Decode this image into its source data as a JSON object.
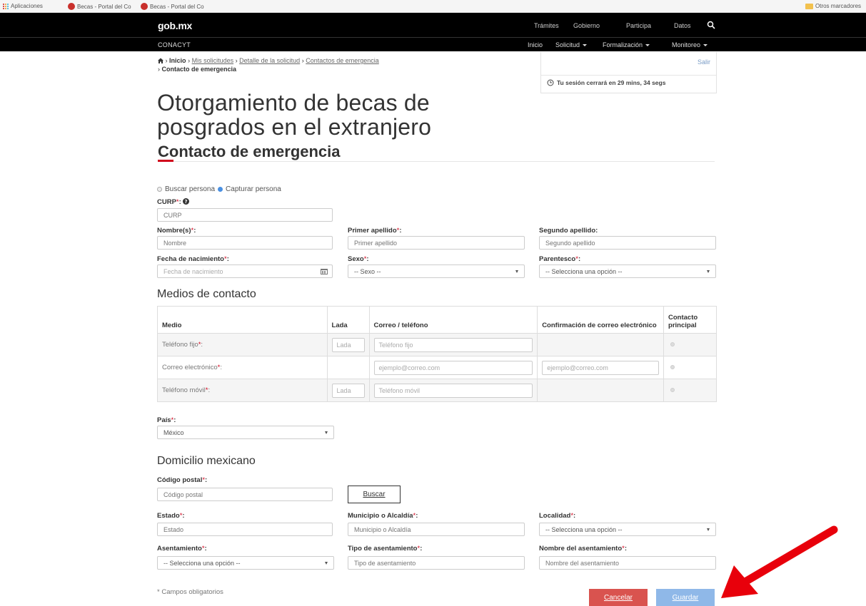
{
  "browser": {
    "bookmarks": [
      {
        "label": "Aplicaciones",
        "icon": "apps-grid-icon"
      },
      {
        "label": "Becas - Portal del Co",
        "icon": "red-circle-icon"
      },
      {
        "label": "Becas - Portal del Co",
        "icon": "red-circle-icon"
      }
    ],
    "other_bookmarks": "Otros marcadores"
  },
  "gob": {
    "logo": "gob.mx",
    "nav": [
      "Trámites",
      "Gobierno",
      "Participa",
      "Datos"
    ]
  },
  "conacyt": {
    "brand": "CONACYT",
    "nav": [
      "Inicio",
      "Solicitud",
      "Formalización",
      "Monitoreo"
    ]
  },
  "breadcrumb": {
    "home": "Inicio",
    "sep": "›",
    "links": [
      "Mis solicitudes",
      "Detalle de la solicitud",
      "Contactos de emergencia"
    ],
    "current": "Contacto de emergencia"
  },
  "session": {
    "logout": "Salir",
    "timer": "Tu sesión cerrará en 29 mins, 34 segs"
  },
  "page": {
    "title_line1": "Otorgamiento de becas de",
    "title_line2": "posgrados en el extranjero",
    "subtitle": "Contacto de emergencia",
    "accent_color": "#d0021b"
  },
  "form": {
    "mode": {
      "option_search": "Buscar persona",
      "option_capture": "Capturar persona",
      "selected": "Capturar persona"
    },
    "curp": {
      "label": "CURP",
      "placeholder": "CURP"
    },
    "nombre": {
      "label": "Nombre(s)",
      "placeholder": "Nombre"
    },
    "primer_apellido": {
      "label": "Primer apellido",
      "placeholder": "Primer apellido"
    },
    "segundo_apellido": {
      "label": "Segundo apellido:",
      "placeholder": "Segundo apellido"
    },
    "fecha": {
      "label": "Fecha de nacimiento",
      "placeholder": "Fecha de nacimiento"
    },
    "sexo": {
      "label": "Sexo",
      "value": "-- Sexo --"
    },
    "parentesco": {
      "label": "Parentesco",
      "value": "-- Selecciona una opción --"
    },
    "req_mark": "*",
    "colon": ":"
  },
  "contact": {
    "heading": "Medios de contacto",
    "headers": [
      "Medio",
      "Lada",
      "Correo / teléfono",
      "Confirmación de correo electrónico",
      "Contacto principal"
    ],
    "rows": [
      {
        "medio": "Teléfono fijo",
        "lada": "Lada",
        "valor": "Teléfono fijo",
        "confirm": ""
      },
      {
        "medio": "Correo electrónico",
        "lada": "",
        "valor": "ejemplo@correo.com",
        "confirm": "ejemplo@correo.com"
      },
      {
        "medio": "Teléfono móvil",
        "lada": "Lada",
        "valor": "Teléfono móvil",
        "confirm": ""
      }
    ]
  },
  "pais": {
    "label": "País",
    "value": "México"
  },
  "domicilio": {
    "heading": "Domicilio mexicano",
    "cp": {
      "label": "Código postal",
      "placeholder": "Código postal"
    },
    "buscar": "Buscar",
    "estado": {
      "label": "Estado",
      "placeholder": "Estado"
    },
    "municipio": {
      "label": "Municipio o Alcaldía",
      "placeholder": "Municipio o Alcaldía"
    },
    "localidad": {
      "label": "Localidad",
      "value": "-- Selecciona una opción --"
    },
    "asentamiento": {
      "label": "Asentamiento",
      "value": "-- Selecciona una opción --"
    },
    "tipo_asentamiento": {
      "label": "Tipo de asentamiento",
      "placeholder": "Tipo de asentamiento"
    },
    "nombre_asentamiento": {
      "label": "Nombre del asentamiento",
      "placeholder": "Nombre del asentamiento"
    }
  },
  "footer": {
    "note": "* Campos obligatorios",
    "cancel": "Cancelar",
    "save": "Guardar",
    "cancel_color": "#d9534f",
    "save_color": "#8fb8e8"
  },
  "annotation": {
    "arrow_color": "#e8000b",
    "icon": "red-arrow-icon"
  }
}
